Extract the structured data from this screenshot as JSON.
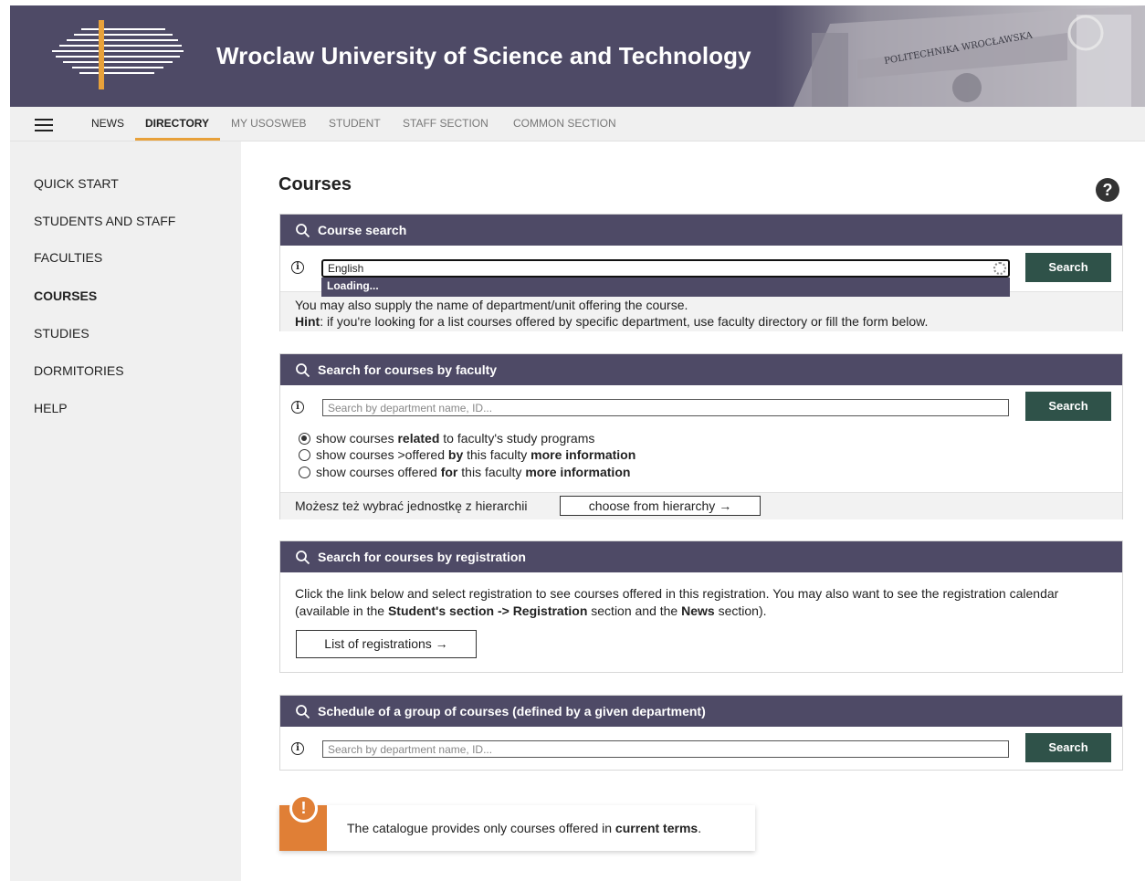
{
  "banner": {
    "title": "Wroclaw University of Science and Technology",
    "inscription": "POLITECHNIKA WROCŁAWSKA"
  },
  "nav": {
    "items": [
      "NEWS",
      "DIRECTORY",
      "MY USOSWEB",
      "STUDENT",
      "STAFF SECTION",
      "COMMON SECTION"
    ],
    "active": "DIRECTORY"
  },
  "sidebar": {
    "items": [
      "QUICK START",
      "STUDENTS AND STAFF",
      "FACULTIES",
      "COURSES",
      "STUDIES",
      "DORMITORIES",
      "HELP"
    ],
    "active": "COURSES"
  },
  "page": {
    "title": "Courses",
    "help_symbol": "?"
  },
  "course_search": {
    "header": "Course search",
    "input_value": "English",
    "dropdown_text": "Loading...",
    "button": "Search",
    "note": "You may also supply the name of department/unit offering the course.",
    "hint_label": "Hint",
    "hint_text": ": if you're looking for a list courses offered by specific department, use faculty directory or fill the form below."
  },
  "faculty_search": {
    "header": "Search for courses by faculty",
    "placeholder": "Search by department name, ID...",
    "button": "Search",
    "options": [
      {
        "pre": "show courses ",
        "bold": "related",
        "post": " to faculty's study programs",
        "more": "",
        "checked": true
      },
      {
        "pre": "show courses >offered ",
        "bold": "by",
        "post": " this faculty ",
        "more": "more information",
        "checked": false
      },
      {
        "pre": "show courses offered ",
        "bold": "for",
        "post": " this faculty ",
        "more": "more information",
        "checked": false
      }
    ],
    "hierarchy_text": "Możesz też wybrać jednostkę z hierarchii",
    "hierarchy_button": "choose from hierarchy →"
  },
  "registration_search": {
    "header": "Search for courses by registration",
    "text_1": "Click the link below and select registration to see courses offered in this registration. You may also want to see the registration calendar (available in the ",
    "text_bold_1": "Student's section -> Registration",
    "text_2": " section and the ",
    "text_bold_2": "News",
    "text_3": " section).",
    "button": "List of registrations →"
  },
  "schedule_search": {
    "header": "Schedule of a group of courses (defined by a given department)",
    "placeholder": "Search by department name, ID...",
    "button": "Search"
  },
  "notice": {
    "symbol": "!",
    "text": "The catalogue provides only courses offered in ",
    "bold": "current terms",
    "end": "."
  },
  "colors": {
    "header_purple": "#4e4a66",
    "button_green": "#2f5249",
    "accent_orange": "#e8a13a",
    "notice_orange": "#e07f36"
  }
}
